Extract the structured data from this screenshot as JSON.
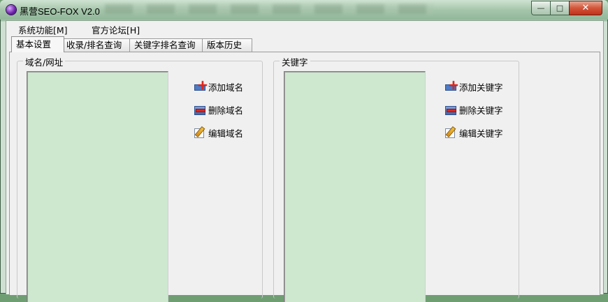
{
  "window": {
    "title": "黑营SEO-FOX V2.0",
    "controls": {
      "minimize": "—",
      "maximize": "□",
      "close": "✕"
    }
  },
  "menu": {
    "items": [
      {
        "label": "系统功能[M]"
      },
      {
        "label": "官方论坛[H]"
      }
    ]
  },
  "tabs": [
    {
      "label": "基本设置",
      "active": true
    },
    {
      "label": "收录/排名查询",
      "active": false
    },
    {
      "label": "关键字排名查询",
      "active": false
    },
    {
      "label": "版本历史",
      "active": false
    }
  ],
  "domain_group": {
    "label": "域名/网址",
    "actions": {
      "add": "添加域名",
      "delete": "删除域名",
      "edit": "编辑域名"
    }
  },
  "keyword_group": {
    "label": "关键字",
    "actions": {
      "add": "添加关键字",
      "delete": "删除关键字",
      "edit": "编辑关键字"
    }
  },
  "colors": {
    "listbox_bg": "#cde8cf",
    "titlebar": "#a6c6ab",
    "close_button": "#d2553a"
  }
}
